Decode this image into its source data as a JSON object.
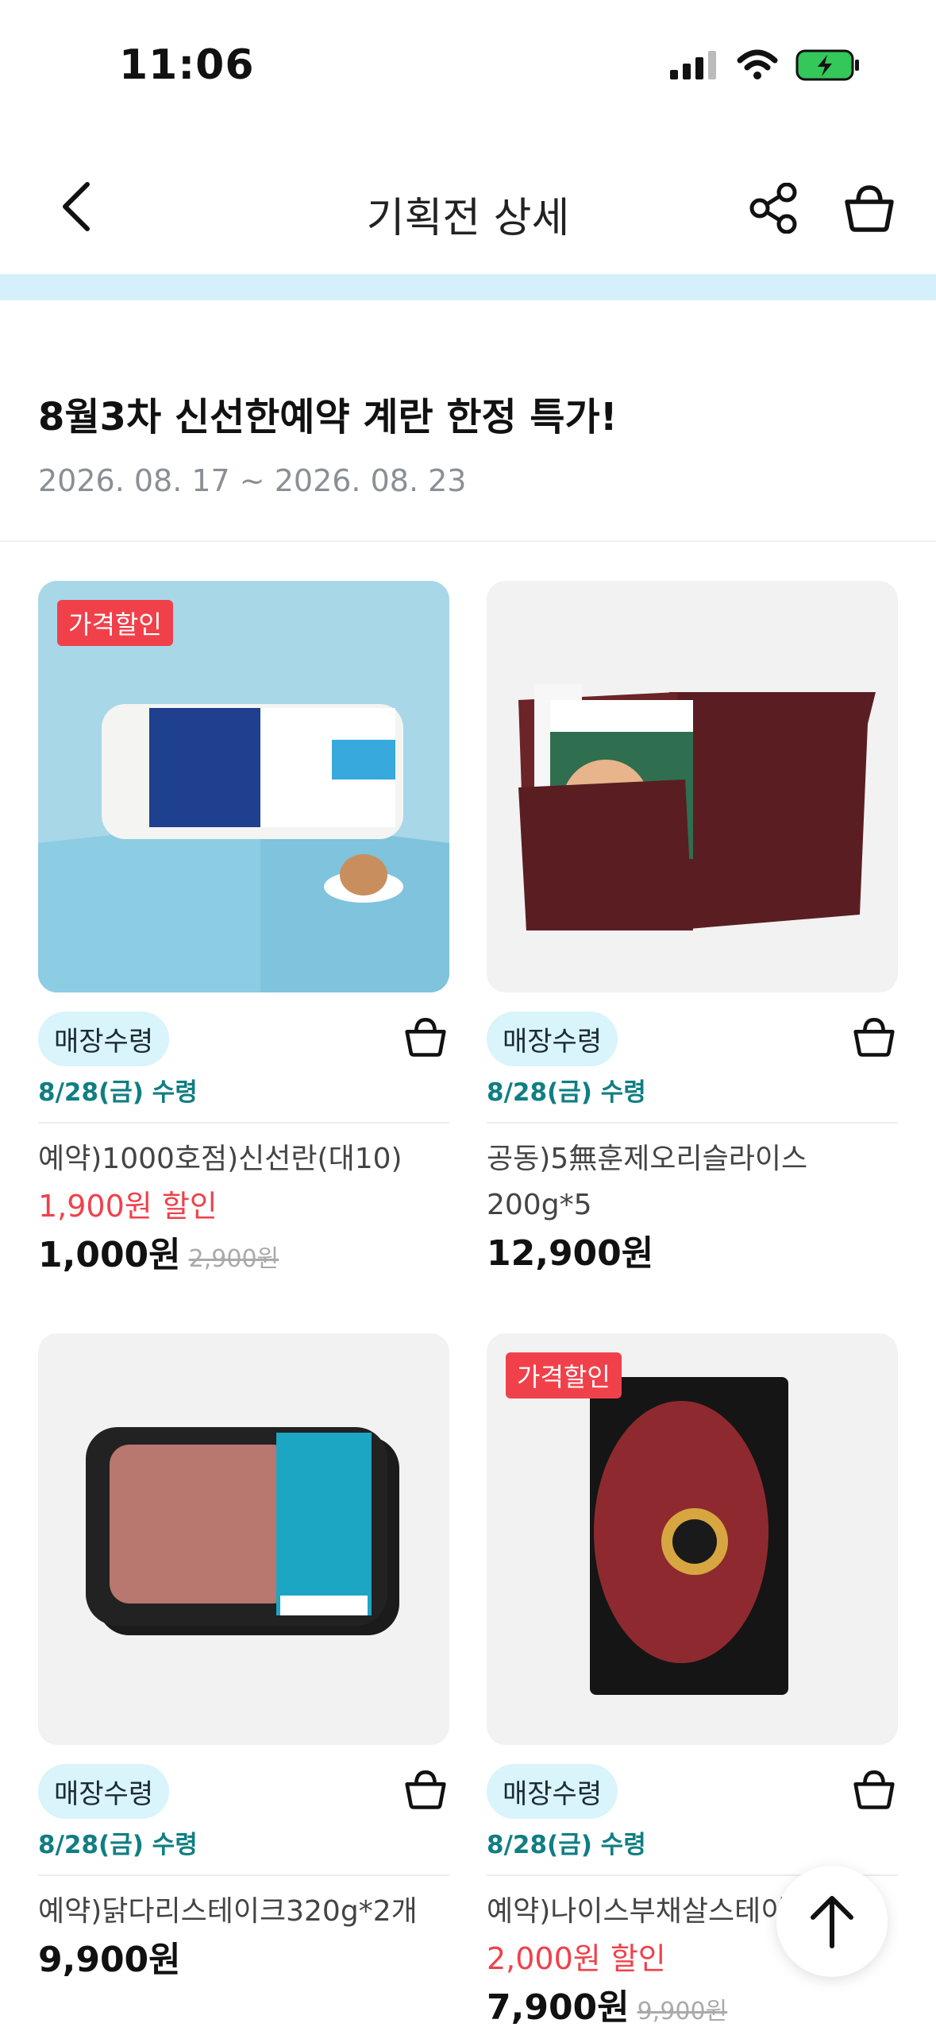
{
  "status_bar": {
    "time": "11:06"
  },
  "header": {
    "title": "기획전 상세"
  },
  "event": {
    "title": "8월3차 신선한예약 계란 한정 특가!",
    "period": "2026. 08. 17 ~ 2026. 08. 23"
  },
  "products": [
    {
      "sale_tag": "가격할인",
      "pickup_badge": "매장수령",
      "pickup_date": "8/28(금) 수령",
      "name": "예약)1000호점)신선란(대10)",
      "discount": "1,900원 할인",
      "price": "1,000원",
      "original_price": "2,900원"
    },
    {
      "pickup_badge": "매장수령",
      "pickup_date": "8/28(금) 수령",
      "name": "공동)5無훈제오리슬라이스 200g*5",
      "price": "12,900원"
    },
    {
      "pickup_badge": "매장수령",
      "pickup_date": "8/28(금) 수령",
      "name": "예약)닭다리스테이크320g*2개",
      "price": "9,900원"
    },
    {
      "sale_tag": "가격할인",
      "pickup_badge": "매장수령",
      "pickup_date": "8/28(금) 수령",
      "name": "예약)나이스부채살스테이크",
      "discount": "2,000원 할인",
      "price": "7,900원",
      "original_price": "9,900원"
    }
  ],
  "colors": {
    "accent_teal": "#107e83",
    "sale_red": "#f0414b",
    "badge_bg": "#d9f4fa"
  }
}
